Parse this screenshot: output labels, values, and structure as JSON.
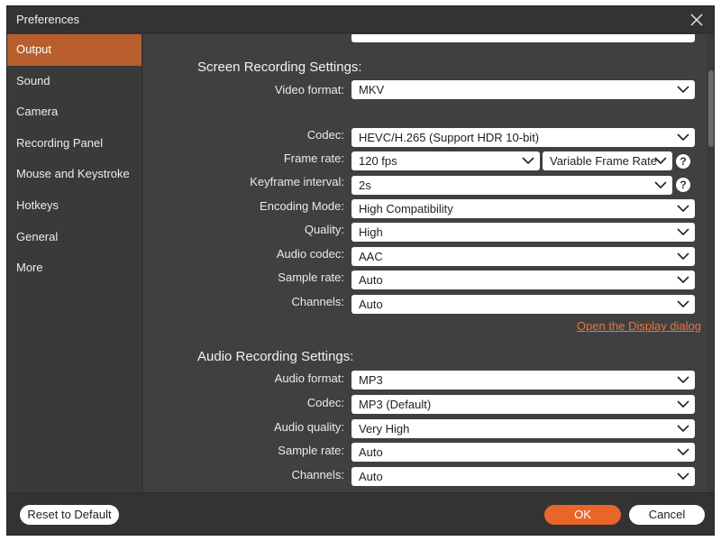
{
  "window": {
    "title": "Preferences"
  },
  "sidebar": {
    "items": [
      {
        "label": "Output"
      },
      {
        "label": "Sound"
      },
      {
        "label": "Camera"
      },
      {
        "label": "Recording Panel"
      },
      {
        "label": "Mouse and Keystroke"
      },
      {
        "label": "Hotkeys"
      },
      {
        "label": "General"
      },
      {
        "label": "More"
      }
    ],
    "active": "Output"
  },
  "screen_recording": {
    "title": "Screen Recording Settings:",
    "video_format": {
      "label": "Video format:",
      "value": "MKV"
    },
    "codec": {
      "label": "Codec:",
      "value": "HEVC/H.265 (Support HDR 10-bit)"
    },
    "frame_rate": {
      "label": "Frame rate:",
      "value": "120 fps",
      "mode": "Variable Frame Rate"
    },
    "keyframe_interval": {
      "label": "Keyframe interval:",
      "value": "2s"
    },
    "encoding_mode": {
      "label": "Encoding Mode:",
      "value": "High Compatibility"
    },
    "quality": {
      "label": "Quality:",
      "value": "High"
    },
    "audio_codec": {
      "label": "Audio codec:",
      "value": "AAC"
    },
    "sample_rate": {
      "label": "Sample rate:",
      "value": "Auto"
    },
    "channels": {
      "label": "Channels:",
      "value": "Auto"
    },
    "display_link": "Open the Display dialog"
  },
  "audio_recording": {
    "title": "Audio Recording Settings:",
    "audio_format": {
      "label": "Audio format:",
      "value": "MP3"
    },
    "codec": {
      "label": "Codec:",
      "value": "MP3 (Default)"
    },
    "audio_quality": {
      "label": "Audio quality:",
      "value": "Very High"
    },
    "sample_rate": {
      "label": "Sample rate:",
      "value": "Auto"
    },
    "channels": {
      "label": "Channels:",
      "value": "Auto"
    }
  },
  "footer": {
    "reset_label": "Reset to Default",
    "ok_label": "OK",
    "cancel_label": "Cancel"
  },
  "help_glyph": "?",
  "colors": {
    "accent": "#e8662a",
    "sidebar_active": "#b85f2d",
    "link": "#e8773e",
    "content_bg": "#404040",
    "window_bg": "#3a3a3a"
  },
  "icons": [
    "close-icon",
    "chevron-down-icon",
    "help-icon"
  ]
}
